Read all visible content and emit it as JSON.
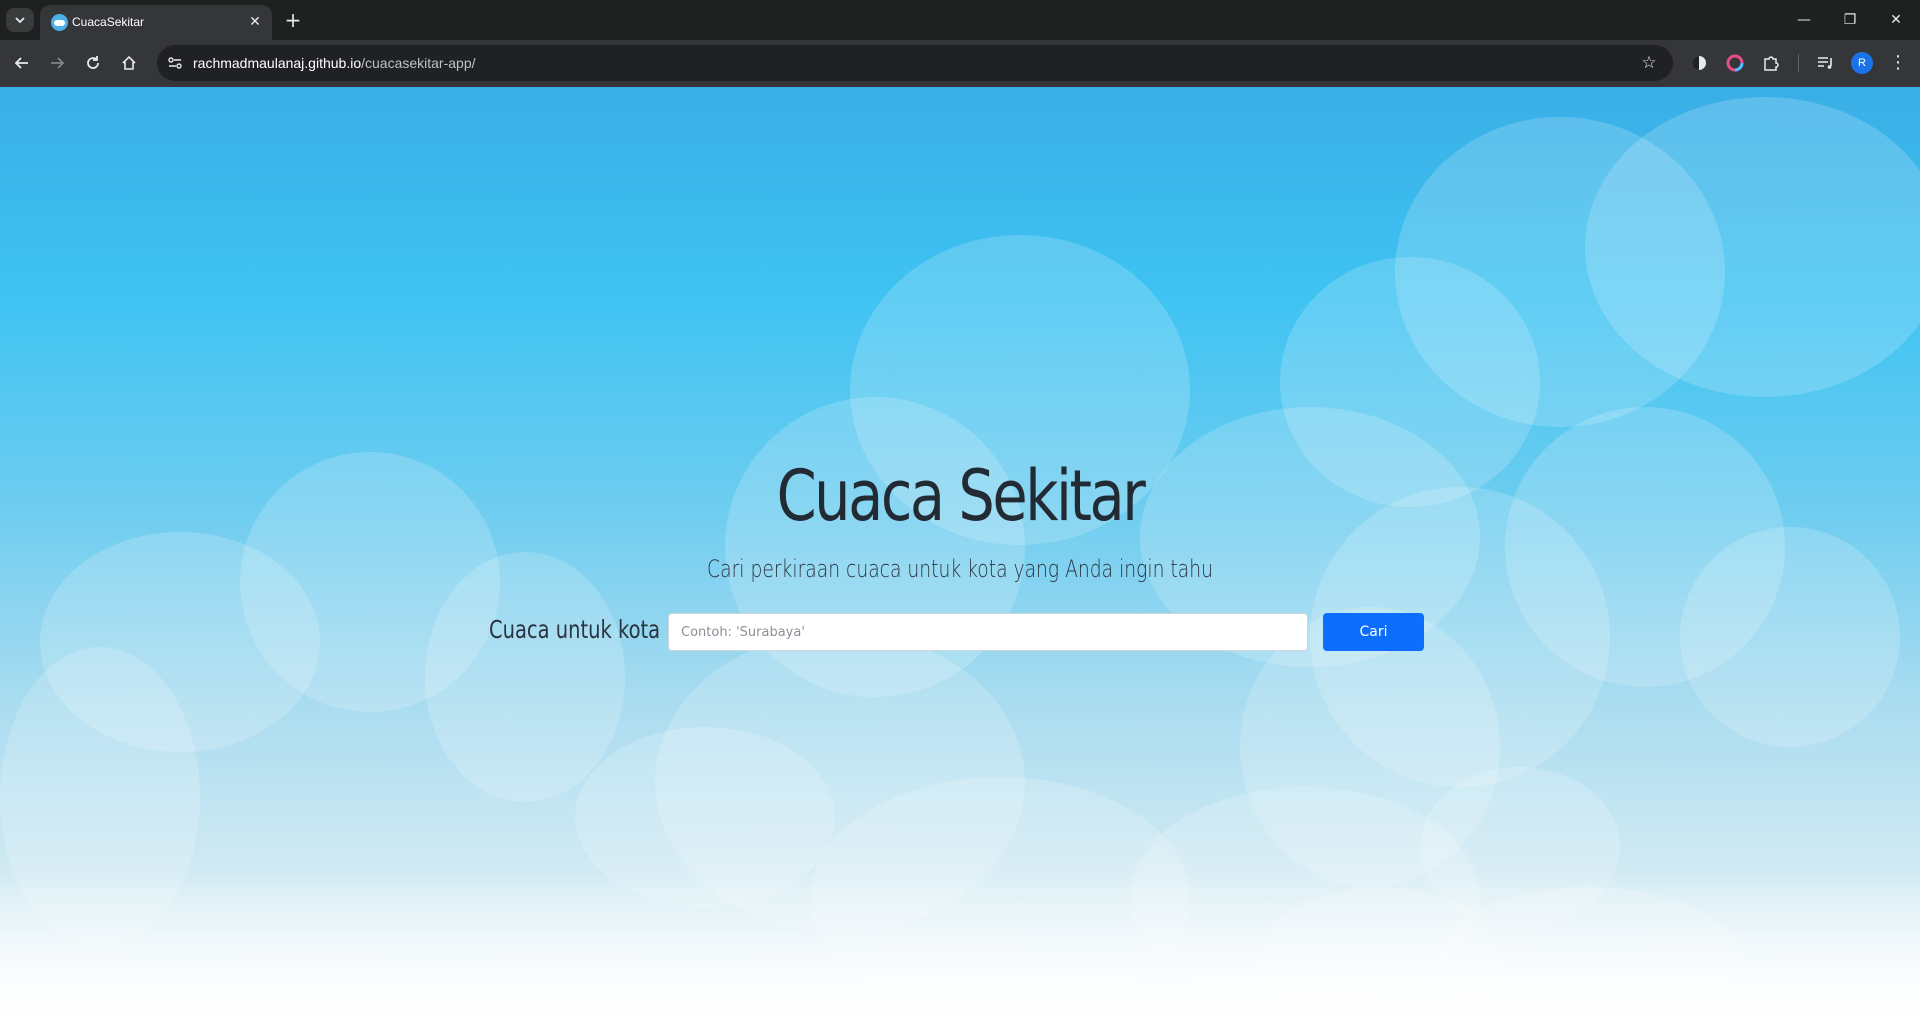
{
  "browser": {
    "tab": {
      "title": "CuacaSekitar",
      "close_glyph": "✕",
      "favicon": "cloud-favicon"
    },
    "new_tab_glyph": "+",
    "window_controls": {
      "minimize": "—",
      "restore": "❐",
      "close": "✕"
    },
    "address": {
      "host": "rachmadmaulanaj.github.io",
      "path": "/cuacasekitar-app/"
    },
    "bookmark_glyph": "☆",
    "profile_initial": "R",
    "menu_glyph": "⋮"
  },
  "page": {
    "title": "Cuaca Sekitar",
    "subtitle": "Cari perkiraan cuaca untuk kota yang Anda ingin tahu",
    "search": {
      "label": "Cuaca untuk kota",
      "placeholder": "Contoh: 'Surabaya'",
      "value": "",
      "button_label": "Cari"
    }
  },
  "colors": {
    "button_primary": "#0d6efd",
    "sky_top": "#3aaee6",
    "text_dark": "#222a33"
  }
}
